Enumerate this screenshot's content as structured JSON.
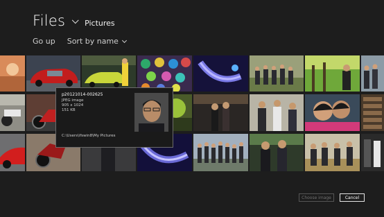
{
  "header": {
    "title": "Files",
    "location": "Pictures"
  },
  "commands": {
    "go_up": "Go up",
    "sort": "Sort by name"
  },
  "tooltip": {
    "name": "p20121014-002625",
    "type": "JPEG image",
    "dimensions": "905 x 1024",
    "size": "151 KB",
    "path": "C:\\Users\\ifswin8\\My Pictures"
  },
  "buttons": {
    "choose": "Choose image",
    "cancel": "Cancel"
  }
}
